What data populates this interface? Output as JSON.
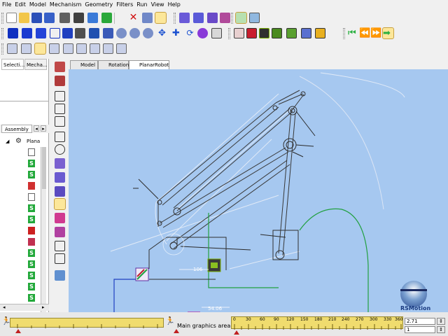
{
  "menu": [
    "File",
    "Edit",
    "Model",
    "Mechanism",
    "Geometry",
    "Filters",
    "Run",
    "View",
    "Help"
  ],
  "panel": {
    "top_tabs": [
      "Selecti...",
      "Mecha..."
    ],
    "tree_tab": "Assembly",
    "tree_root_label": "Plana",
    "tree_icon_letter": "S"
  },
  "doc_tabs": [
    "Model",
    "Rotation",
    "PlanarRobot"
  ],
  "view": {
    "dim_label_1": "106",
    "dim_label_2": "54.06",
    "logo_text": "RSMotion"
  },
  "status": {
    "main_label": "Main graphics area",
    "timeline_ticks": [
      "0",
      "30",
      "60",
      "90",
      "120",
      "150",
      "180",
      "210",
      "240",
      "270",
      "300",
      "330",
      "360"
    ],
    "time_field_1": "2.71",
    "time_field_2": "1"
  },
  "colors": {
    "viewport_bg": "#a6c8f0",
    "ruler": "#f0dc6e",
    "green_icon": "#22a83a",
    "selected_tool": "#fce79a"
  },
  "icons": {
    "toolbar_row1": [
      "new-file-icon",
      "open-folder-icon",
      "save-icon",
      "save-all-icon",
      "print-icon",
      "camera-icon",
      "undo-icon",
      "redo-icon",
      "delete-icon",
      "tools-icon",
      "lightbulb-icon",
      "part-icon",
      "part-add-icon",
      "part-remove-icon",
      "part-edit-icon",
      "layout-icon",
      "analysis-icon"
    ],
    "toolbar_row2": [
      "cube-solid-icon",
      "cube-front-icon",
      "cube-side-icon",
      "cube-wire-icon",
      "cube-iso-icon",
      "display-icon",
      "drop-icon",
      "fit-icon",
      "zoom-out-icon",
      "zoom-in-icon",
      "zoom-box-icon",
      "zoom-fit-icon",
      "pan-icon",
      "rotate-icon",
      "sphere-icon",
      "select-icon",
      "motion-1-icon",
      "motion-2-icon",
      "motion-3-icon",
      "motion-4-icon",
      "motion-5-icon",
      "motion-6-icon",
      "motion-7-icon",
      "first-frame-icon",
      "prev-frame-icon",
      "play-icon",
      "last-frame-icon"
    ],
    "toolbar_row3": [
      "joint-1-icon",
      "joint-2-icon",
      "joint-3-icon",
      "joint-4-icon",
      "joint-5-icon",
      "joint-6-icon",
      "joint-7-icon",
      "joint-8-icon",
      "joint-9-icon"
    ]
  }
}
